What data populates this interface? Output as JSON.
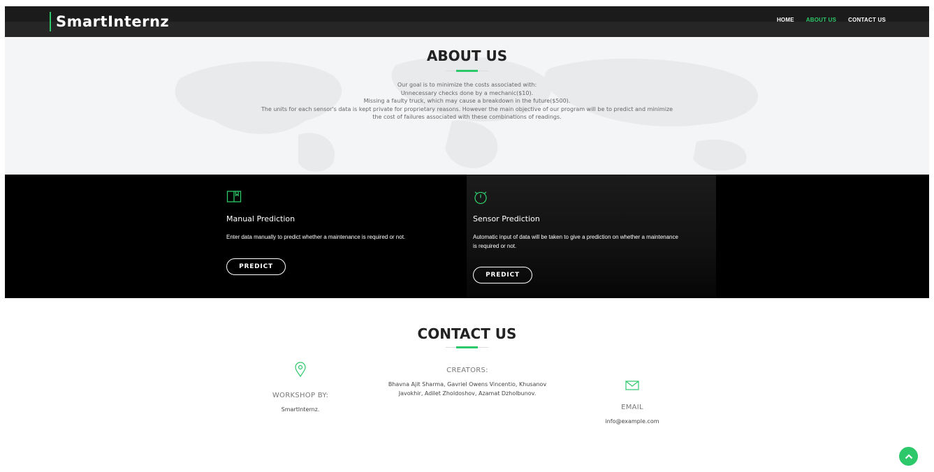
{
  "nav": {
    "brand": "SmartInternz",
    "links": [
      "HOME",
      "ABOUT US",
      "CONTACT US"
    ],
    "active_link": "ABOUT US"
  },
  "about": {
    "title": "ABOUT US",
    "lines": [
      "Our goal is to minimize the costs associated with:",
      "Unnecessary checks done by a mechanic($10).",
      "Missing a faulty truck, which may cause a breakdown in the future($500).",
      "The units for each sensor's data is kept private for proprietary reasons. However the main objective of our program will be to predict and minimize",
      "the cost of failures associated with these combinations of readings."
    ]
  },
  "services": [
    {
      "icon": "book-icon",
      "title": "Manual Prediction",
      "description": "Enter data manually to predict whether a maintenance is required or not.",
      "button_label": "PREDICT"
    },
    {
      "icon": "stopwatch-icon",
      "title": "Sensor Prediction",
      "description": "Automatic input of data will be taken to give a prediction on whether a maintenance is required or not.",
      "button_label": "PREDICT"
    }
  ],
  "contact": {
    "title": "CONTACT US",
    "workshop": {
      "icon": "location-pin-icon",
      "label": "WORKSHOP BY:",
      "value": "SmartInternz."
    },
    "creators": {
      "label": "CREATORS:",
      "value": "Bhavna Ajit Sharma, Gavriel Owens Vincentio, Khusanov Javokhir, Adilet Zholdoshov, Azamat Dzholbunov."
    },
    "email": {
      "icon": "envelope-icon",
      "label": "EMAIL",
      "value": "info@example.com"
    }
  },
  "colors": {
    "accent": "#2dc86a",
    "dark": "#000000",
    "nav": "#1b1b1b"
  }
}
